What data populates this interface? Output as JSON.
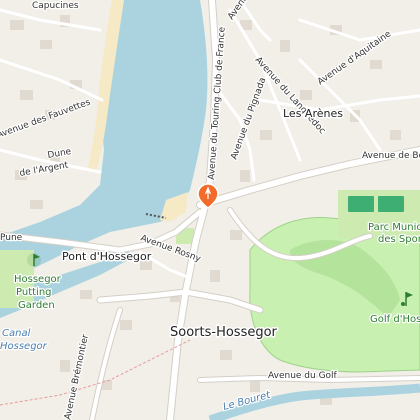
{
  "map": {
    "labels": {
      "capucines": "Capucines",
      "avenue_top": "Avenue",
      "av_aquitaine": "Avenue d'Aquitaine",
      "av_languedoc": "Avenue du Languedoc",
      "av_fauvettes": "Avenue des Fauvettes",
      "les_arenes": "Les Arènes",
      "av_dune": "Dune",
      "av_argent": "de l'Argent",
      "av_touring": "Avenue du Touring Club de France",
      "av_pignada": "Avenue du Pignada",
      "av_bo": "Avenue de Bo",
      "pune": "Pune",
      "pont_hossegor": "Pont d'Hossegor",
      "av_rosny": "Avenue Rosny",
      "hossegor_putting": "Hossegor",
      "putting": "Putting",
      "garden": "Garden",
      "parc_municipal": "Parc Munici",
      "des_sports": "des Sport",
      "soorts_hossegor": "Soorts-Hossegor",
      "canal": "Canal",
      "canal_hossegor": "Hossegor",
      "golf": "Golf d'Hos",
      "av_golf": "Avenue du Golf",
      "le_bouret": "Le Bouret",
      "av_bremontier": "Avenue Brémontier"
    },
    "colors": {
      "water": "#aad3df",
      "sand": "#f5e9c6",
      "golf": "#c8f0b0",
      "park": "#cdebb0",
      "marker": "#f26b2a",
      "land": "#f2efe9"
    },
    "marker_icon": "location-pin-icon"
  }
}
